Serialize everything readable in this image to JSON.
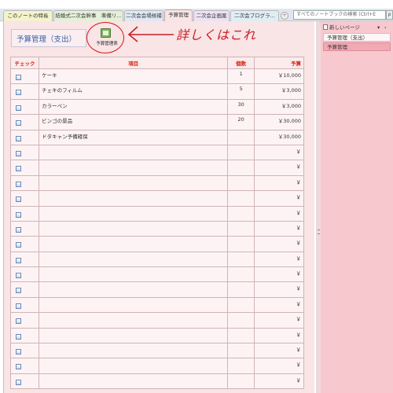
{
  "tabs": [
    {
      "label": "このノートの特長"
    },
    {
      "label": "結婚式二次会幹事　準備リ..."
    },
    {
      "label": "二次会会場候補"
    },
    {
      "label": "予算管理"
    },
    {
      "label": "二次会企画案"
    },
    {
      "label": "二次会プログラ..."
    }
  ],
  "search": {
    "placeholder": "すべてのノートブックの検索 (Ctrl+E",
    "button": "ρ"
  },
  "page": {
    "title": "予算管理（支出）",
    "attachment_label": "予算管理表",
    "handwritten_note": "詳しくはこれ"
  },
  "table": {
    "headers": {
      "check": "チェック",
      "item": "項目",
      "qty": "個数",
      "budget": "予算"
    },
    "rows": [
      {
        "item": "ケーキ",
        "qty": "1",
        "budget": "￥10,000"
      },
      {
        "item": "チェキのフィルム",
        "qty": "5",
        "budget": "￥3,000"
      },
      {
        "item": "カラーペン",
        "qty": "30",
        "budget": "￥3,000"
      },
      {
        "item": "ビンゴの景品",
        "qty": "20",
        "budget": "￥30,000"
      },
      {
        "item": "ドタキャン予備確保",
        "qty": "",
        "budget": "￥30,000"
      },
      {
        "item": "",
        "qty": "",
        "budget": "￥"
      },
      {
        "item": "",
        "qty": "",
        "budget": "￥"
      },
      {
        "item": "",
        "qty": "",
        "budget": "￥"
      },
      {
        "item": "",
        "qty": "",
        "budget": "￥"
      },
      {
        "item": "",
        "qty": "",
        "budget": "￥"
      },
      {
        "item": "",
        "qty": "",
        "budget": "￥"
      },
      {
        "item": "",
        "qty": "",
        "budget": "￥"
      },
      {
        "item": "",
        "qty": "",
        "budget": "￥"
      },
      {
        "item": "",
        "qty": "",
        "budget": "￥"
      },
      {
        "item": "",
        "qty": "",
        "budget": "￥"
      },
      {
        "item": "",
        "qty": "",
        "budget": "￥"
      },
      {
        "item": "",
        "qty": "",
        "budget": "￥"
      },
      {
        "item": "",
        "qty": "",
        "budget": "￥"
      },
      {
        "item": "",
        "qty": "",
        "budget": "￥"
      },
      {
        "item": "",
        "qty": "",
        "budget": "￥"
      },
      {
        "item": "",
        "qty": "",
        "budget": "￥"
      }
    ]
  },
  "right_pane": {
    "new_page": "新しいページ",
    "pages": [
      "予算管理（支出）",
      "予算管理"
    ]
  },
  "colors": {
    "page_bg": "#f9e4e6",
    "header_text": "#d9220f",
    "annotation": "#c61e25",
    "pane_bg": "#f7c9cf"
  }
}
